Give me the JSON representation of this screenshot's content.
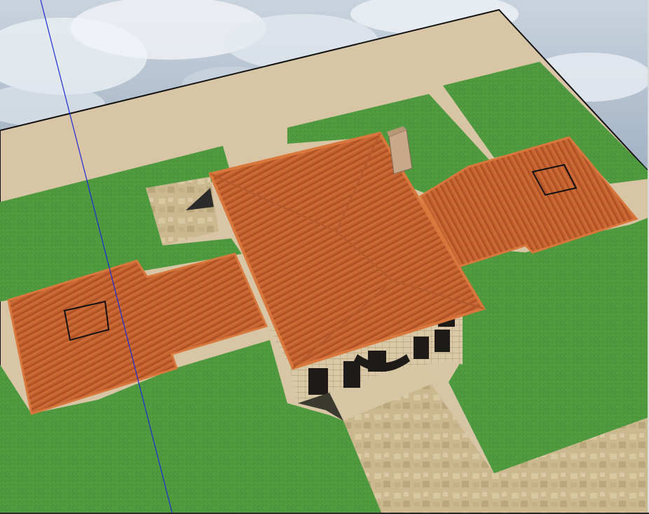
{
  "app": {
    "window_title": ""
  },
  "viewport": {
    "kind": "3d-model-view",
    "camera": "aerial-perspective",
    "sky": "cloudy",
    "axis_visible": "blue-z-axis",
    "colors": {
      "sky_light": "#e9eef3",
      "sky_dark": "#8ea2b7",
      "ground_grass": "#4f9a3f",
      "grass_dark": "#3f8a32",
      "sand": "#d8c5a6",
      "paving": "#cbb88e",
      "roof_tile": "#c4622f",
      "roof_edge": "#d9783d",
      "wall_stone": "#d9c9a8",
      "window_dark": "#1d1a18",
      "axis_blue": "#1c2bd6",
      "edge_black": "#111111"
    }
  },
  "model": {
    "objects": [
      {
        "name": "ground-plane",
        "label": ""
      },
      {
        "name": "driveway",
        "label": ""
      },
      {
        "name": "main-roof",
        "label": ""
      },
      {
        "name": "left-wing-roof",
        "label": ""
      },
      {
        "name": "right-wing-roof",
        "label": ""
      },
      {
        "name": "chimney",
        "label": ""
      },
      {
        "name": "front-facade",
        "label": ""
      },
      {
        "name": "entry-path",
        "label": ""
      },
      {
        "name": "rear-terrace",
        "label": ""
      }
    ]
  }
}
